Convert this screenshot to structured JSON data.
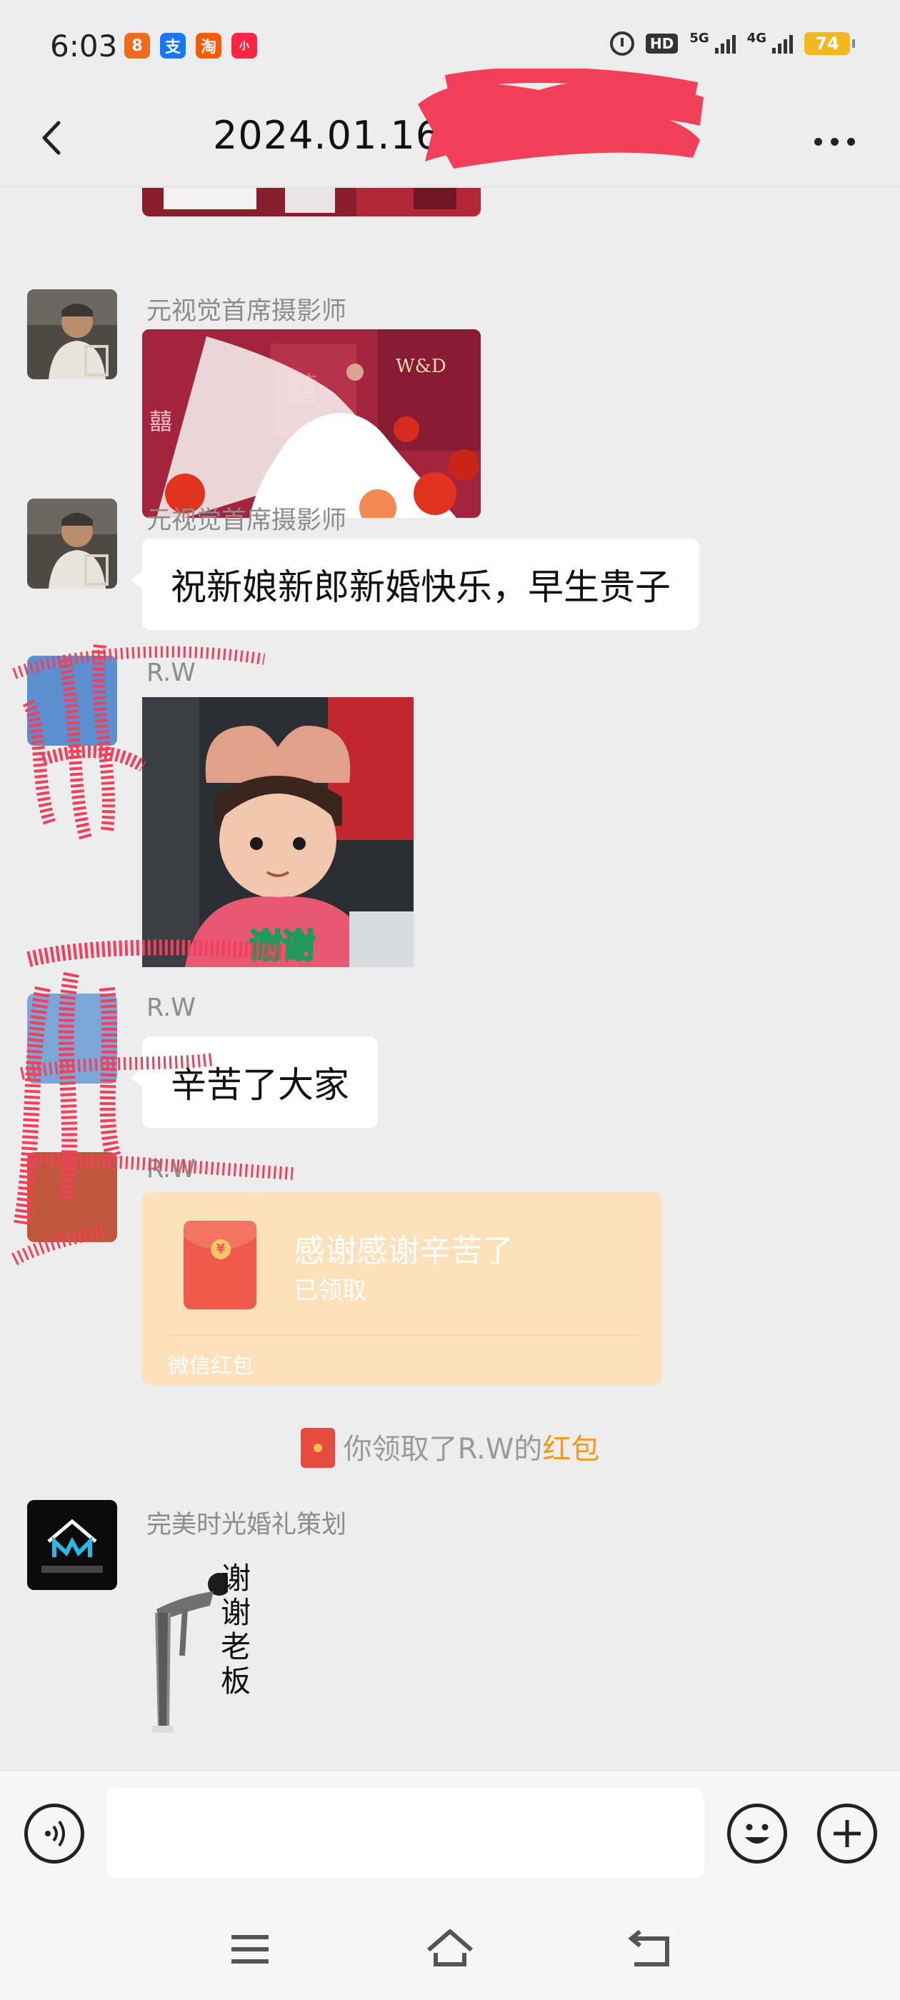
{
  "status_bar": {
    "time": "6:03",
    "apps": [
      "meituan-icon",
      "alipay-icon",
      "taobao-icon",
      "xiaohongshu-icon"
    ],
    "network": "HD",
    "net_5g": "5G",
    "net_4g": "4G",
    "battery": "74"
  },
  "header": {
    "title": "2024.01.16"
  },
  "messages": [
    {
      "type": "image",
      "sender": "",
      "description_icon": "wedding-photo-icon"
    },
    {
      "type": "image",
      "sender": "元视觉首席摄影师"
    },
    {
      "type": "text",
      "sender": "元视觉首席摄影师",
      "text": "祝新娘新郎新婚快乐，早生贵子"
    },
    {
      "type": "sticker",
      "sender": "R.W",
      "sticker_text": "谢谢"
    },
    {
      "type": "text",
      "sender": "R.W",
      "text": "辛苦了大家"
    },
    {
      "type": "red_packet",
      "sender": "R.W",
      "title": "感谢感谢辛苦了",
      "status": "已领取",
      "footer": "微信红包"
    },
    {
      "type": "system",
      "prefix": "你领取了R.W的",
      "link": "红包"
    },
    {
      "type": "sticker",
      "sender": "完美时光婚礼策划",
      "sticker_text": "谢谢老板"
    }
  ],
  "colors": {
    "background": "#ededed",
    "bubble": "#ffffff",
    "red_packet": "#fde1bb",
    "link": "#f39a1a",
    "scribble": "#f2405a"
  }
}
